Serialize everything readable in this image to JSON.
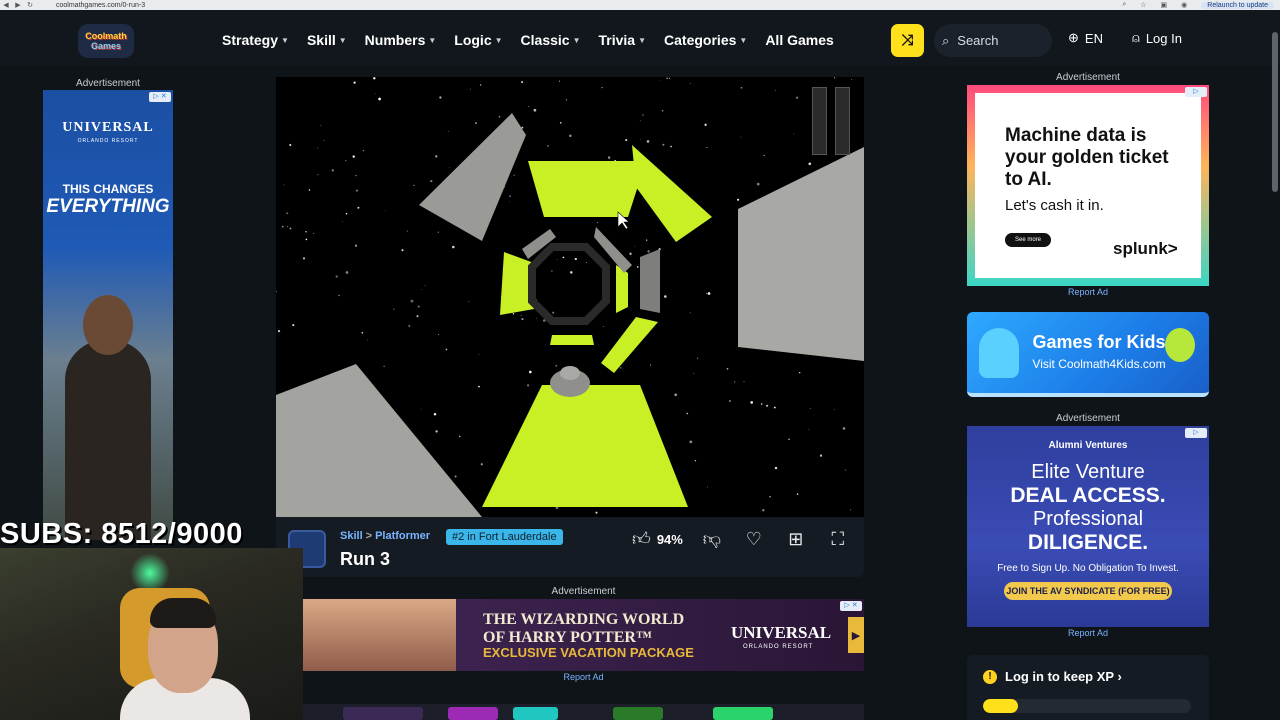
{
  "browser": {
    "url": "coolmathgames.com/0-run-3",
    "relaunch_label": "Relaunch to update"
  },
  "header": {
    "logo_line1": "Coolmath",
    "logo_line2": "Games",
    "nav": [
      "Strategy",
      "Skill",
      "Numbers",
      "Logic",
      "Classic",
      "Trivia",
      "Categories"
    ],
    "all_games": "All Games",
    "search_placeholder": "Search",
    "lang": "EN",
    "login": "Log In"
  },
  "left_ad": {
    "label": "Advertisement",
    "brand": "UNIVERSAL",
    "brand_sub": "ORLANDO RESORT",
    "tagline1": "THIS CHANGES",
    "tagline2": "EVERYTHING"
  },
  "game": {
    "category": "Skill",
    "subcategory": "Platformer",
    "rank_badge": "#2 in Fort Lauderdale",
    "title": "Run 3",
    "like_percent": "94%"
  },
  "mid_ad": {
    "label": "Advertisement",
    "line1": "THE WIZARDING WORLD",
    "line1b": "OF HARRY POTTER™",
    "line2": "EXCLUSIVE VACATION PACKAGE",
    "brand": "UNIVERSAL",
    "brand_sub": "ORLANDO RESORT",
    "report": "Report Ad"
  },
  "stream": {
    "subs_counter": "SUBS: 8512/9000"
  },
  "right_ad1": {
    "label": "Advertisement",
    "headline": "Machine data is your golden ticket to AI.",
    "sub": "Let's cash it in.",
    "button": "See more",
    "brand": "splunk>",
    "report": "Report Ad"
  },
  "kids_card": {
    "title": "Games for Kids",
    "subtitle": "Visit Coolmath4Kids.com"
  },
  "right_ad2": {
    "label": "Advertisement",
    "brand": "Alumni Ventures",
    "l1": "Elite Venture",
    "l2": "DEAL ACCESS.",
    "l3": "Professional",
    "l4": "DILIGENCE.",
    "l5": "Free to Sign Up. No Obligation To Invest.",
    "cta": "JOIN THE AV SYNDICATE (FOR FREE)",
    "report": "Report Ad"
  },
  "xp": {
    "text": "Log in to keep XP",
    "progress": 0.17
  },
  "colors": {
    "accent_yellow": "#ffe11b",
    "tunnel_green": "#c8f024",
    "link_blue": "#7bb4ff",
    "badge_blue": "#3bb6e8"
  }
}
